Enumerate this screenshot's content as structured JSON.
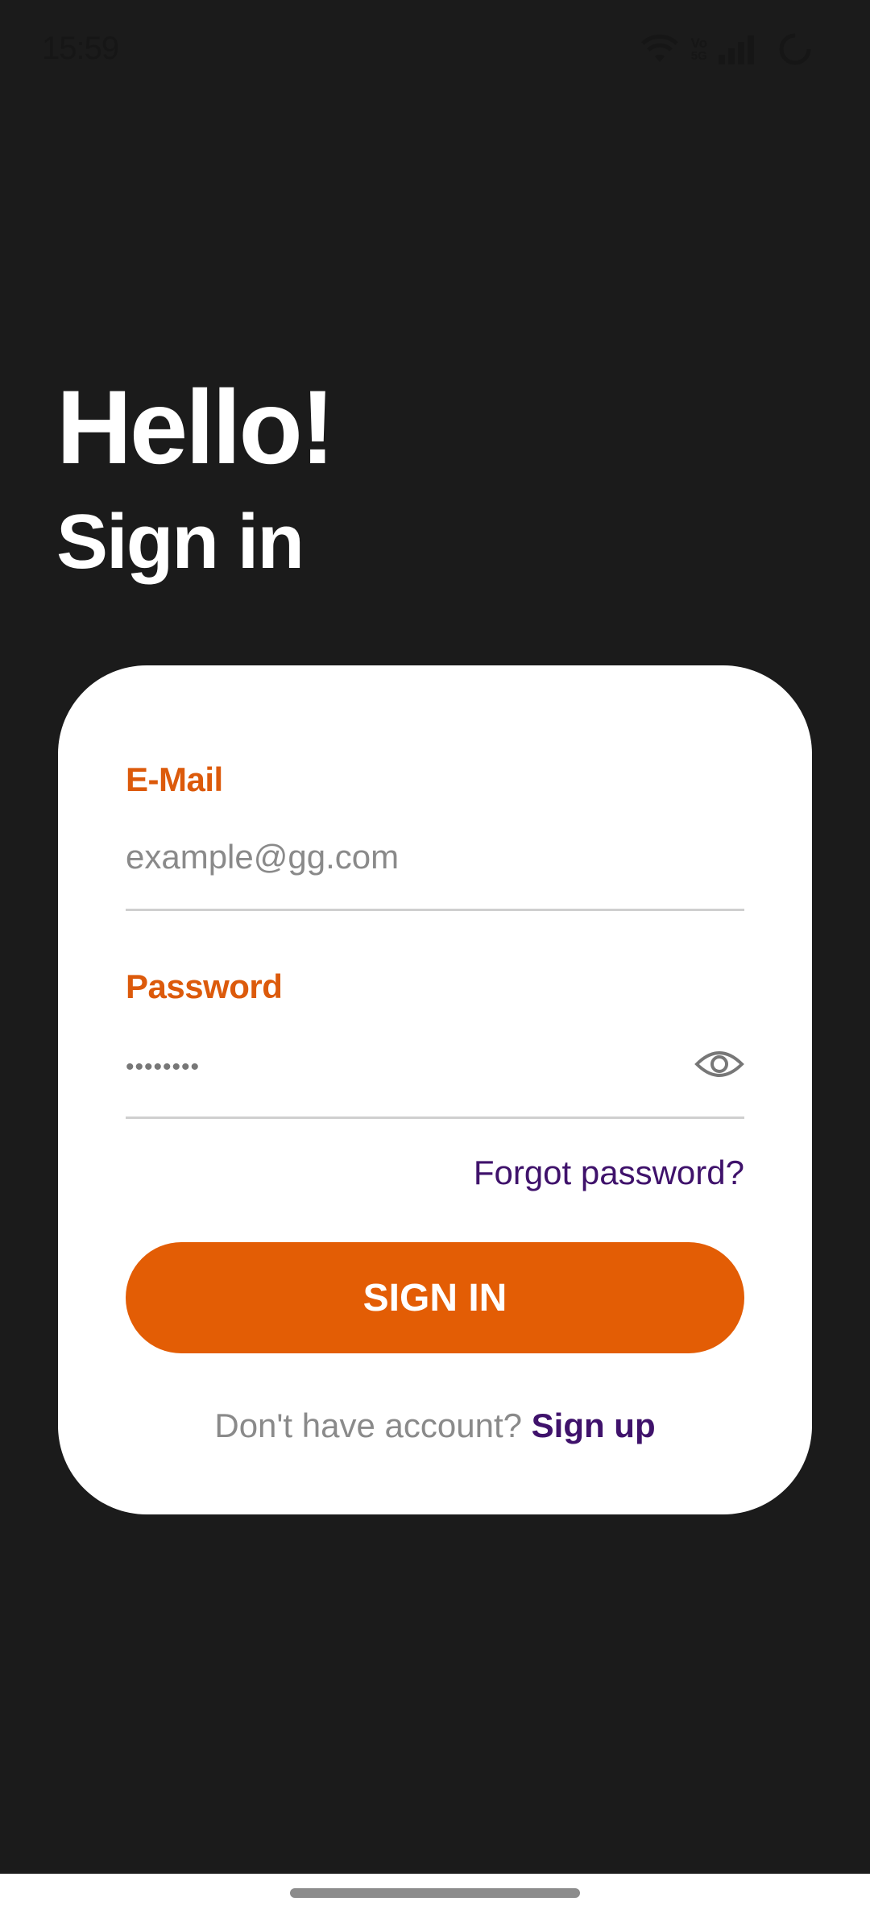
{
  "status_bar": {
    "time": "15:59",
    "icons": [
      "wifi-icon",
      "volte-icon",
      "signal-bars-icon",
      "loading-ring-icon"
    ],
    "volte_label": "Vo",
    "volte_sub": "5G"
  },
  "header": {
    "title": "Hello!",
    "subtitle": "Sign in"
  },
  "form": {
    "email": {
      "label": "E-Mail",
      "placeholder": "example@gg.com",
      "value": ""
    },
    "password": {
      "label": "Password",
      "masked_value": "••••••••",
      "toggle_icon": "eye-icon"
    },
    "forgot_link": "Forgot password?",
    "submit_label": "SIGN IN",
    "signup_prompt": "Don't have account?",
    "signup_link": "Sign up"
  },
  "colors": {
    "background": "#1b1b1b",
    "card": "#ffffff",
    "accent_orange": "#e35d05",
    "label_orange": "#dc5a0b",
    "link_purple": "#3f126b",
    "muted_text": "#8a8a8a"
  }
}
